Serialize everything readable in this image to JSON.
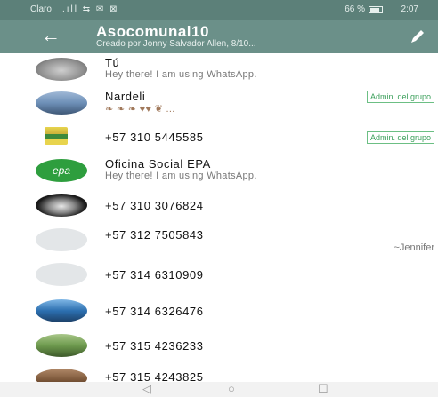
{
  "status_bar": {
    "carrier": "Claro",
    "signal_icons": ".ıll ⇆ ✉ ⊠",
    "battery": "66 %",
    "time": "2:07"
  },
  "app_bar": {
    "title": "Asocomunal10",
    "subtitle": "Creado por Jonny Salvador Allen, 8/10..."
  },
  "participants": [
    {
      "name": "Tú",
      "status": "Hey there! I am using WhatsApp.",
      "badge": "",
      "nick": ""
    },
    {
      "name": "Nardeli",
      "status": "❧ ❧ ❧ ♥♥ ❦ ...",
      "badge": "Admin. del grupo",
      "nick": ""
    },
    {
      "name": "+57 310 5445585",
      "status": "",
      "badge": "Admin. del grupo",
      "nick": ""
    },
    {
      "name": "Oficina Social EPA",
      "status": "Hey there! I am using WhatsApp.",
      "badge": "",
      "nick": ""
    },
    {
      "name": "+57 310 3076824",
      "status": "",
      "badge": "",
      "nick": ""
    },
    {
      "name": "+57 312 7505843",
      "status": "",
      "badge": "",
      "nick": "~Jennifer"
    },
    {
      "name": "+57 314 6310909",
      "status": "",
      "badge": "",
      "nick": ""
    },
    {
      "name": "+57 314 6326476",
      "status": "",
      "badge": "",
      "nick": ""
    },
    {
      "name": "+57 315 4236233",
      "status": "",
      "badge": "",
      "nick": ""
    },
    {
      "name": "+57 315 4243825",
      "status": "",
      "badge": "",
      "nick": ""
    }
  ],
  "nav": {
    "back": "◁",
    "home": "○",
    "recents": "☐"
  },
  "colors": {
    "app_bar": "#6b9089",
    "status_bar": "#5c8079",
    "admin_badge": "#3da05c"
  },
  "icons": [
    "back-arrow-icon",
    "edit-pencil-icon"
  ]
}
